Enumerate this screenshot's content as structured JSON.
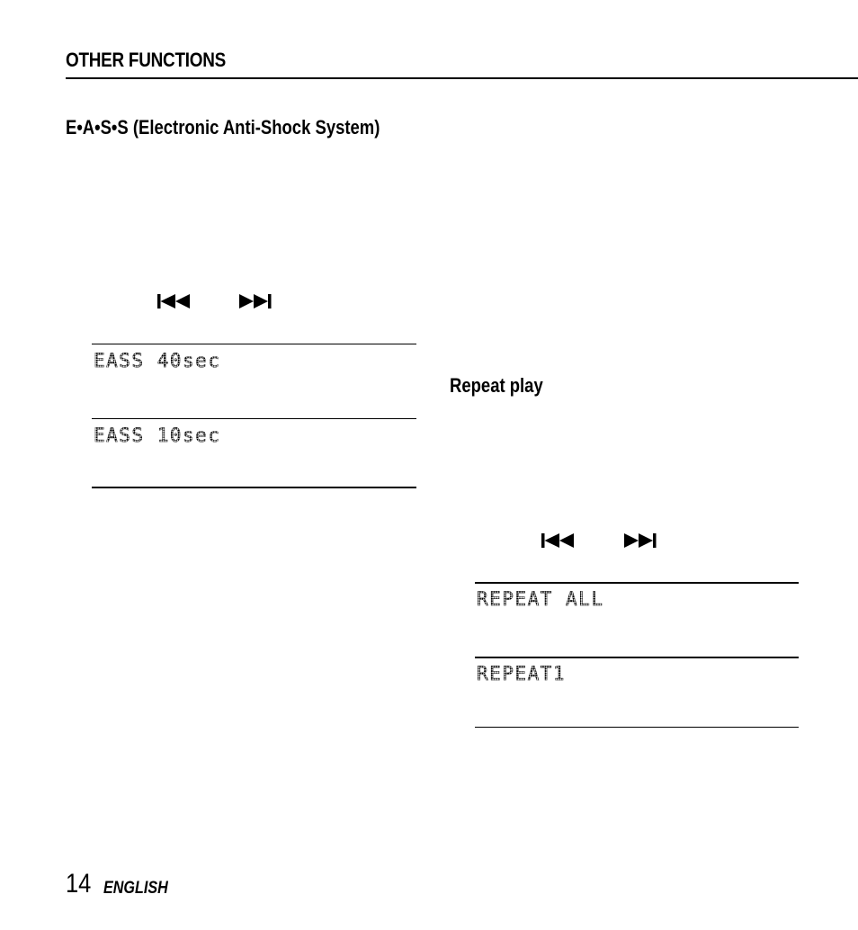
{
  "header": {
    "section_title": "OTHER FUNCTIONS"
  },
  "eass": {
    "heading": "E•A•S•S (Electronic Anti-Shock System)",
    "buttons": [
      {
        "icon": "skip-back-icon",
        "glyph": "⏮"
      },
      {
        "icon": "skip-forward-icon",
        "glyph": "⏭"
      }
    ],
    "displays": [
      "EASS 40sec",
      "EASS 10sec"
    ]
  },
  "repeat": {
    "heading": "Repeat play",
    "buttons": [
      {
        "icon": "skip-back-icon",
        "glyph": "⏮"
      },
      {
        "icon": "skip-forward-icon",
        "glyph": "⏭"
      }
    ],
    "displays": [
      "REPEAT ALL",
      "REPEAT1"
    ]
  },
  "footer": {
    "page_number": "14",
    "language": "ENGLISH"
  }
}
